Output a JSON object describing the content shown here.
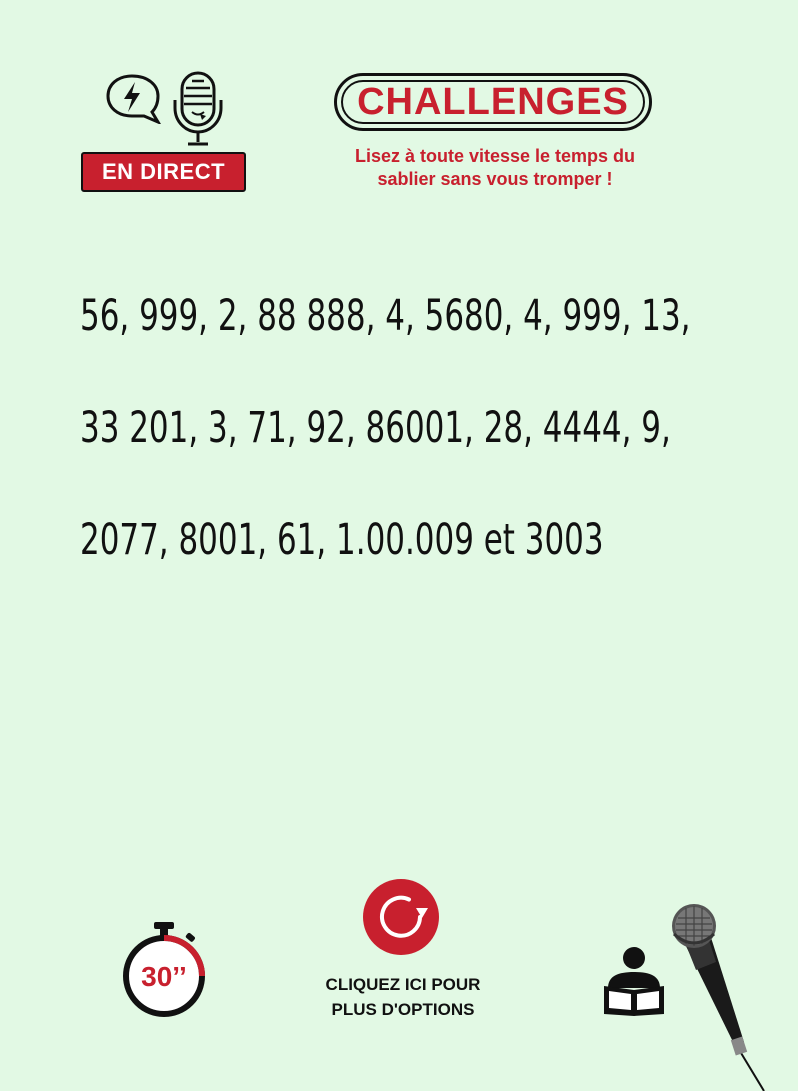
{
  "header": {
    "live_badge": "EN DIRECT",
    "title": "CHALLENGES",
    "subtitle_line1": "Lisez à toute vitesse le temps du",
    "subtitle_line2": "sablier sans vous tromper !"
  },
  "challenge": {
    "line1": "56, 999, 2, 88 888, 4, 5680, 4, 999, 13,",
    "line2": "33 201, 3, 71, 92, 86001, 28, 4444, 9,",
    "line3": "2077, 8001, 61, 1.00.009 et 3003"
  },
  "footer": {
    "timer_label": "30’’",
    "options_line1": "CLIQUEZ ICI POUR",
    "options_line2": "PLUS D'OPTIONS"
  },
  "colors": {
    "background": "#e2f9e4",
    "accent_red": "#c8202e",
    "text": "#111111"
  },
  "icons": [
    "speech-bubble-lightning-icon",
    "podcast-mic-icon",
    "stopwatch-icon",
    "refresh-icon",
    "reader-icon",
    "handheld-mic-icon"
  ]
}
